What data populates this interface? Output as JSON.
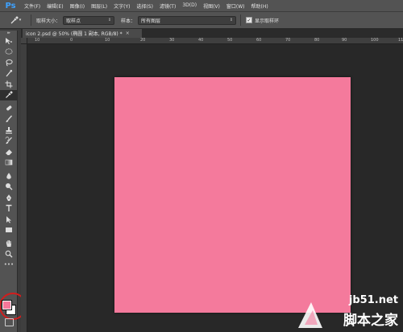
{
  "app": {
    "logo": "Ps"
  },
  "menu": [
    "文件(F)",
    "编辑(E)",
    "图像(I)",
    "图层(L)",
    "文字(Y)",
    "选择(S)",
    "滤镜(T)",
    "3D(D)",
    "视图(V)",
    "窗口(W)",
    "帮助(H)"
  ],
  "options": {
    "sample_size_label": "取样大小：",
    "sample_size_value": "取样点",
    "sample_label": "样本：",
    "sample_value": "所有图层",
    "show_ring_label": "显示取样环",
    "show_ring_checked": true
  },
  "document": {
    "tab_title": "icon 2.psd @ 50% (椭圆 1 副本, RGB/8) *",
    "close_glyph": "×",
    "canvas_color": "#f47a9c"
  },
  "ruler": {
    "top_numbers": [
      "10",
      "0",
      "10",
      "20",
      "30",
      "40",
      "50",
      "60",
      "70",
      "80",
      "90",
      "100",
      "110"
    ]
  },
  "colors": {
    "foreground": "#f5789a",
    "background": "#ffffff"
  },
  "tools": [
    "move-tool",
    "marquee-tool",
    "lasso-tool",
    "quick-selection-tool",
    "crop-tool",
    "eyedropper-tool",
    "spot-healing-tool",
    "brush-tool",
    "clone-stamp-tool",
    "history-brush-tool",
    "eraser-tool",
    "gradient-tool",
    "blur-tool",
    "dodge-tool",
    "pen-tool",
    "type-tool",
    "path-selection-tool",
    "rectangle-tool",
    "hand-tool",
    "zoom-tool"
  ],
  "watermark": {
    "site": "jb51.net",
    "name": "脚本之家"
  }
}
